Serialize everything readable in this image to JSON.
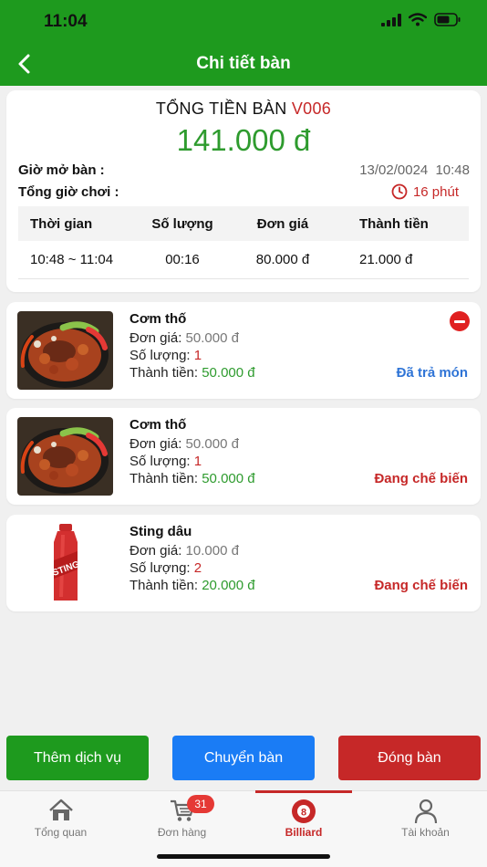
{
  "status_bar": {
    "time": "11:04"
  },
  "header": {
    "title": "Chi tiết bàn"
  },
  "summary": {
    "heading": "TỔNG TIỀN BÀN",
    "table_code": "V006",
    "total": "141.000 đ",
    "open_label": "Giờ mở bàn :",
    "open_date": "13/02/0024",
    "open_time": "10:48",
    "play_label": "Tổng giờ chơi :",
    "play_duration": "16 phút",
    "table": {
      "headers": [
        "Thời gian",
        "Số lượng",
        "Đơn giá",
        "Thành tiền"
      ],
      "rows": [
        {
          "time": "10:48 ~ 11:04",
          "qty": "00:16",
          "price": "80.000 đ",
          "amount": "21.000 đ"
        }
      ]
    }
  },
  "labels": {
    "price": "Đơn giá: ",
    "qty": "Số lượng: ",
    "amount": "Thành tiền: "
  },
  "items": [
    {
      "name": "Cơm thố",
      "price": "50.000 đ",
      "qty": "1",
      "amount": "50.000 đ",
      "status": "Đã trả món",
      "status_color": "#2f74d6",
      "image": "claypot-rice-photo"
    },
    {
      "name": "Cơm thố",
      "price": "50.000 đ",
      "qty": "1",
      "amount": "50.000 đ",
      "status": "Đang chế biến",
      "status_color": "#c62828",
      "image": "claypot-rice-photo"
    },
    {
      "name": "Sting dâu",
      "price": "10.000 đ",
      "qty": "2",
      "amount": "20.000 đ",
      "status": "Đang chế biến",
      "status_color": "#c62828",
      "image": "sting-bottle-photo"
    }
  ],
  "actions": {
    "add_service": "Thêm dịch vụ",
    "move_table": "Chuyển bàn",
    "close_table": "Đóng bàn"
  },
  "tabs": [
    {
      "label": "Tổng quan",
      "icon": "home-icon"
    },
    {
      "label": "Đơn hàng",
      "icon": "cart-icon",
      "badge": "31"
    },
    {
      "label": "Billiard",
      "icon": "billiard-ball-icon",
      "active": true
    },
    {
      "label": "Tài khoản",
      "icon": "user-icon"
    }
  ],
  "colors": {
    "brand_green": "#1e9a1e",
    "accent_red": "#c62828",
    "blue": "#1a7cf5"
  }
}
